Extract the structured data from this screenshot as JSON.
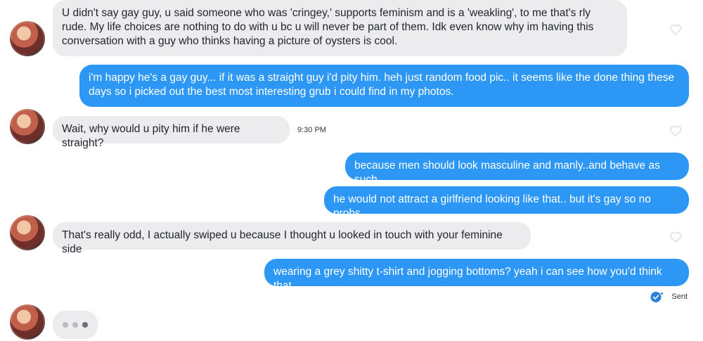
{
  "messages": [
    {
      "from": "them",
      "text": "U didn't say gay guy, u said someone who was  'cringey,' supports feminism and is a 'weakling', to me that's rly rude. My life choices are nothing to do with u bc u will never be part of them. Idk even know why im having this conversation with a guy who thinks having a picture of oysters is cool."
    },
    {
      "from": "me",
      "text": "i'm happy he's a gay guy... if it was a straight guy i'd pity him.    heh just random food pic.. it seems like the done thing these days so i picked out the best most interesting grub i could find in my photos."
    },
    {
      "from": "them",
      "text": "Wait, why would u pity him if he were straight?",
      "time": "9:30 PM"
    },
    {
      "from": "me",
      "text": "because men should look masculine and manly..and behave as such"
    },
    {
      "from": "me",
      "text": "he would not attract a girlfriend looking like that.. but it's gay so no probs"
    },
    {
      "from": "them",
      "text": "That's really odd, I actually swiped u because I thought u looked in touch with your feminine side"
    },
    {
      "from": "me",
      "text": "wearing a grey shitty t-shirt and jogging bottoms? yeah i can see how you'd think that"
    }
  ],
  "status": {
    "sent_label": "Sent"
  },
  "icons": {
    "like": "heart-outline-icon",
    "sent": "check-circle-icon"
  },
  "colors": {
    "outgoing": "#2d97f5",
    "incoming": "#ececef",
    "check": "#2d7fdc"
  }
}
